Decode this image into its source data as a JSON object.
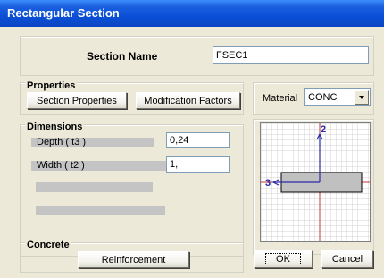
{
  "window": {
    "title": "Rectangular Section"
  },
  "section_name": {
    "label": "Section Name",
    "value": "FSEC1"
  },
  "properties": {
    "heading": "Properties",
    "section_properties_button": "Section Properties",
    "modification_factors_button": "Modification Factors"
  },
  "material": {
    "label": "Material",
    "selected": "CONC"
  },
  "dimensions": {
    "heading": "Dimensions",
    "depth_label": "Depth ( t3 )",
    "depth_value": "0,24",
    "width_label": "Width ( t2 )",
    "width_value": "1,"
  },
  "preview": {
    "axis_2_label": "2",
    "axis_3_label": "3"
  },
  "concrete": {
    "heading": "Concrete",
    "reinforcement_button": "Reinforcement"
  },
  "footer": {
    "ok_label": "OK",
    "cancel_label": "Cancel"
  },
  "colors": {
    "title_blue": "#0a4fd6",
    "axis_blue": "#2a2aa8",
    "axis_red": "#cc3333"
  }
}
